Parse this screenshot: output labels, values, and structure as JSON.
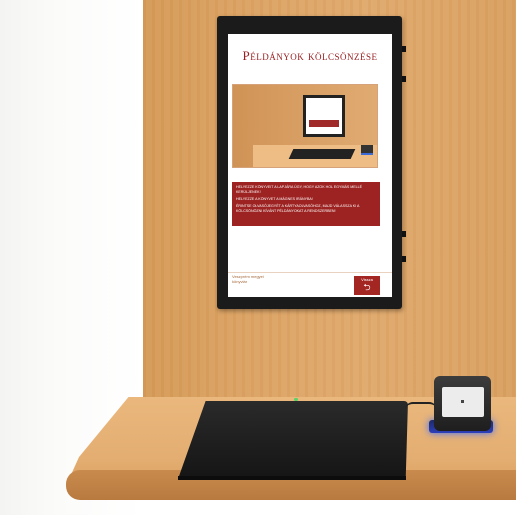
{
  "screen": {
    "title": "Példányok kölcsönzése",
    "instructions": [
      "Helyezze könyveit a lapjára úgy, hogy azok hol egymás mellé kerüljenek!",
      "Helyezze a könyvet a mágnes irányba!",
      "Érintse olvasójegyét a kártyaolvasóhoz, majd válassza ki a kölcsönözni kívánt példányokat a rendszerben!"
    ],
    "logo_text": "Veszprém megyei könyvtár",
    "back_button_label": "Vissza",
    "back_icon": "return-arrow-icon"
  },
  "colors": {
    "accent": "#9d2322",
    "wood": "#dca364"
  }
}
